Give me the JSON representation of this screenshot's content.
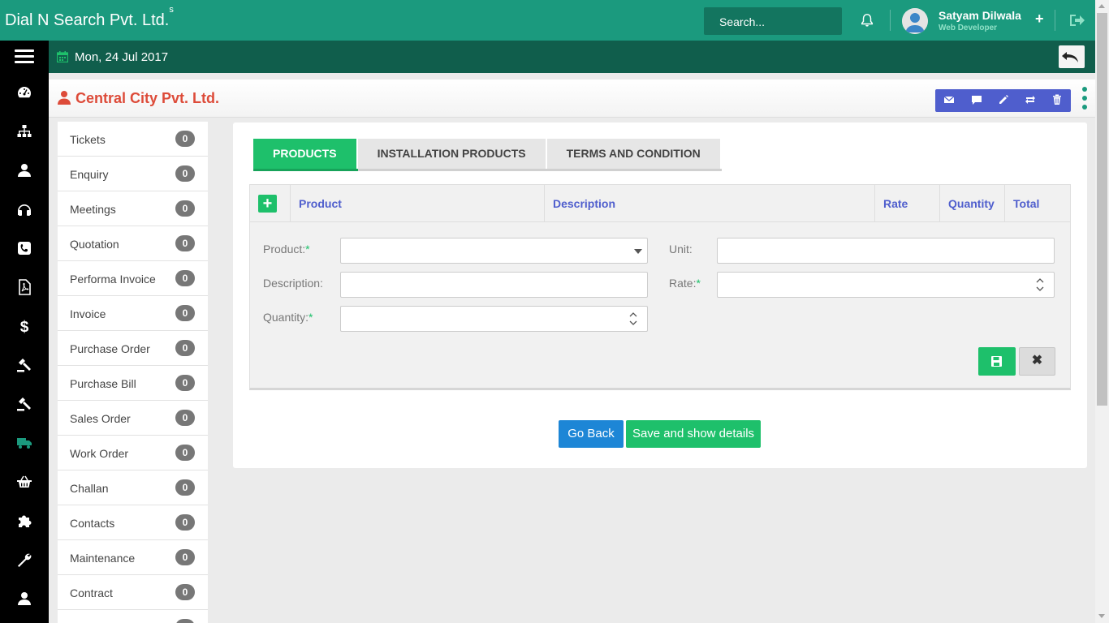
{
  "header": {
    "brand": "Dial N Search Pvt. Ltd.",
    "brand_sup": "s",
    "search_placeholder": "Search...",
    "user_name": "Satyam Dilwala",
    "user_role": "Web Developer",
    "plus_label": "+"
  },
  "subbar": {
    "date": "Mon, 24 Jul 2017"
  },
  "sidebar_icons": [
    "dashboard-icon",
    "org-chart-icon",
    "user-icon",
    "headphones-icon",
    "phone-icon",
    "pdf-icon",
    "dollar-icon",
    "gavel-icon",
    "gavel-icon",
    "truck-icon",
    "basket-icon",
    "puzzle-icon",
    "wrench-icon",
    "user-icon"
  ],
  "company": {
    "name": "Central City Pvt. Ltd."
  },
  "modules": [
    {
      "label": "Tickets",
      "count": "0"
    },
    {
      "label": "Enquiry",
      "count": "0"
    },
    {
      "label": "Meetings",
      "count": "0"
    },
    {
      "label": "Quotation",
      "count": "0"
    },
    {
      "label": "Performa Invoice",
      "count": "0"
    },
    {
      "label": "Invoice",
      "count": "0"
    },
    {
      "label": "Purchase Order",
      "count": "0"
    },
    {
      "label": "Purchase Bill",
      "count": "0"
    },
    {
      "label": "Sales Order",
      "count": "0"
    },
    {
      "label": "Work Order",
      "count": "0"
    },
    {
      "label": "Challan",
      "count": "0"
    },
    {
      "label": "Contacts",
      "count": "0"
    },
    {
      "label": "Maintenance",
      "count": "0"
    },
    {
      "label": "Contract",
      "count": "0"
    },
    {
      "label": "",
      "count": "0"
    }
  ],
  "tabs": [
    {
      "label": "PRODUCTS",
      "active": true
    },
    {
      "label": "INSTALLATION PRODUCTS",
      "active": false
    },
    {
      "label": "TERMS AND CONDITION",
      "active": false
    }
  ],
  "table": {
    "add_label": "+",
    "columns": [
      "Product",
      "Description",
      "Rate",
      "Quantity",
      "Total"
    ]
  },
  "form": {
    "product_label": "Product:",
    "unit_label": "Unit:",
    "description_label": "Description:",
    "rate_label": "Rate:",
    "quantity_label": "Quantity:",
    "required_mark": "*",
    "product_value": "",
    "unit_value": "",
    "description_value": "",
    "rate_value": "",
    "quantity_value": "",
    "close_label": "✖"
  },
  "buttons": {
    "go_back": "Go Back",
    "save_details": "Save and show details"
  },
  "colors": {
    "header": "#1b9a7e",
    "subbar": "#105e4c",
    "accent_green": "#1ec06b",
    "accent_blue": "#4f5ecd",
    "company_red": "#dd4b39"
  }
}
